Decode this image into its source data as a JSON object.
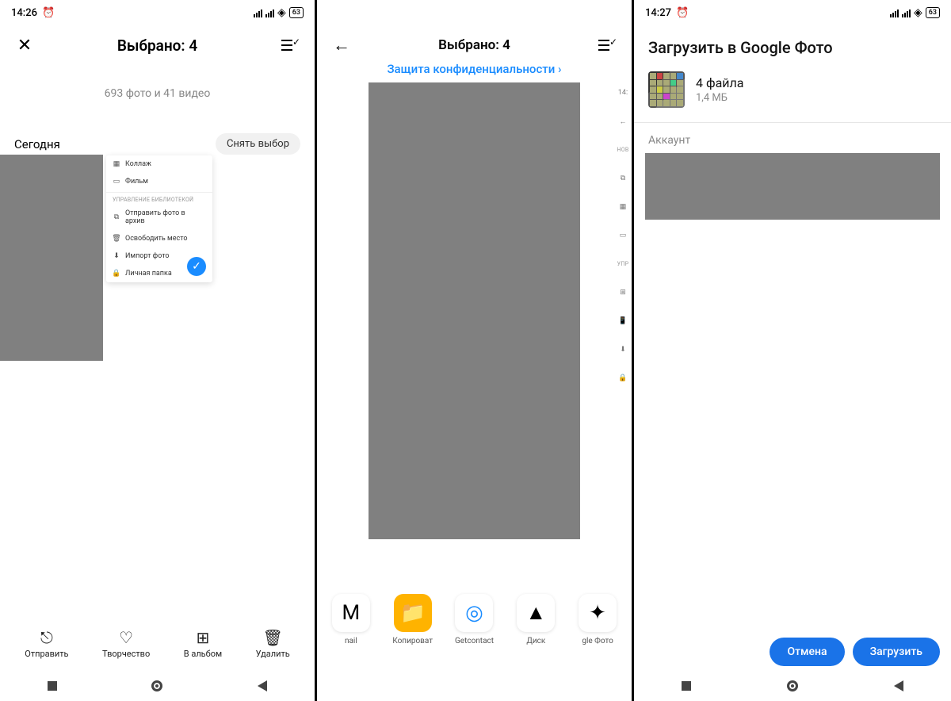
{
  "status": {
    "time1": "14:26",
    "time2": "14:27",
    "battery": "63"
  },
  "pane1": {
    "title": "Выбрано: 4",
    "counts": "693 фото и 41 видео",
    "section": "Сегодня",
    "deselect": "Снять выбор",
    "popup": {
      "items_top": [
        {
          "icon": "▦",
          "label": "Коллаж"
        },
        {
          "icon": "▭",
          "label": "Фильм"
        }
      ],
      "section": "УПРАВЛЕНИЕ БИБЛИОТЕКОЙ",
      "items_bottom": [
        {
          "icon": "⧉",
          "label": "Отправить фото в архив"
        },
        {
          "icon": "🗑",
          "label": "Освободить место"
        },
        {
          "icon": "⬇",
          "label": "Импорт фото"
        },
        {
          "icon": "🔒",
          "label": "Личная папка"
        }
      ]
    },
    "bottom": [
      {
        "icon": "⎋",
        "label": "Отправить"
      },
      {
        "icon": "♡",
        "label": "Творчество"
      },
      {
        "icon": "⊞",
        "label": "В альбом"
      },
      {
        "icon": "🗑",
        "label": "Удалить"
      }
    ]
  },
  "pane2": {
    "title": "Выбрано: 4",
    "subtitle": "Защита конфиденциальности ›",
    "sidestrip": [
      {
        "type": "txt",
        "label": "14:"
      },
      {
        "type": "ic",
        "label": "←"
      },
      {
        "type": "lbl",
        "label": "НОВ"
      },
      {
        "type": "ic",
        "label": "⧉"
      },
      {
        "type": "ic",
        "label": "▦"
      },
      {
        "type": "ic",
        "label": "▭"
      },
      {
        "type": "lbl",
        "label": "УПР"
      },
      {
        "type": "ic",
        "label": "⊞"
      },
      {
        "type": "ic",
        "label": "📱"
      },
      {
        "type": "ic",
        "label": "⬇"
      },
      {
        "type": "ic",
        "label": "🔒"
      }
    ],
    "share": [
      {
        "label": "nail",
        "cls": "ic-mail",
        "glyph": "M"
      },
      {
        "label": "Копироват",
        "cls": "ic-copy",
        "glyph": "📁"
      },
      {
        "label": "Getcontact",
        "cls": "ic-get",
        "glyph": "◎"
      },
      {
        "label": "Диск",
        "cls": "ic-drive",
        "glyph": "▲"
      },
      {
        "label": "gle Фото",
        "cls": "ic-photos",
        "glyph": "✦"
      }
    ]
  },
  "pane3": {
    "title": "Загрузить в Google Фото",
    "files": "4 файла",
    "size": "1,4 МБ",
    "account_label": "Аккаунт",
    "cancel": "Отмена",
    "upload": "Загрузить"
  }
}
